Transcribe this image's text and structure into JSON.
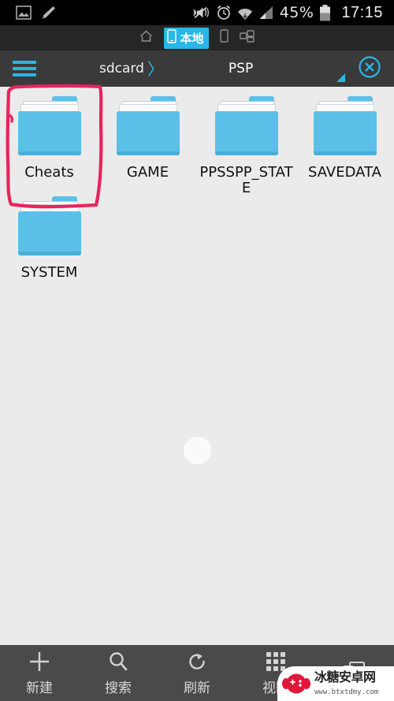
{
  "statusbar": {
    "left_icons": [
      {
        "name": "gallery-icon",
        "label": "gallery"
      },
      {
        "name": "pencil-icon",
        "label": "edit"
      }
    ],
    "right_icons": [
      {
        "name": "vibrate-mute-icon",
        "label": "silent"
      },
      {
        "name": "alarm-clock-icon",
        "label": "alarm"
      },
      {
        "name": "wifi-icon",
        "label": "wifi"
      },
      {
        "name": "signal-bars-icon",
        "label": "signal"
      }
    ],
    "battery_percent": "45%",
    "battery_icon": "battery-icon",
    "clock": "17:15"
  },
  "tabbar": {
    "items": [
      {
        "name": "tab-home",
        "icon": "home-icon",
        "label": "",
        "active": false
      },
      {
        "name": "tab-local",
        "icon": "phone-icon",
        "label": "本地",
        "active": true
      },
      {
        "name": "tab-device",
        "icon": "phone-icon",
        "label": "",
        "active": false
      },
      {
        "name": "tab-network",
        "icon": "network-share-icon",
        "label": "",
        "active": false
      }
    ]
  },
  "toolbar": {
    "menu_icon": "hamburger-menu-icon",
    "breadcrumb": [
      "sdcard",
      "PSP"
    ],
    "separator": "〉",
    "close_icon": "close-circle-icon",
    "accent_color": "#29b6e8"
  },
  "content": {
    "background_color": "#ebebeb",
    "folder_color": "#5bc0e8",
    "items": [
      {
        "name": "folder-cheats",
        "label": "Cheats",
        "icon": "folder-icon",
        "highlighted": true
      },
      {
        "name": "folder-game",
        "label": "GAME",
        "icon": "folder-icon",
        "highlighted": false
      },
      {
        "name": "folder-ppsspp-state",
        "label": "PPSSPP_STATE",
        "icon": "folder-icon",
        "highlighted": false
      },
      {
        "name": "folder-savedata",
        "label": "SAVEDATA",
        "icon": "folder-icon",
        "highlighted": false
      },
      {
        "name": "folder-system",
        "label": "SYSTEM",
        "icon": "folder-icon",
        "highlighted": false
      }
    ],
    "loading_indicator": "loading-spinner"
  },
  "annotation": {
    "color": "#e8245c",
    "target": "Cheats",
    "shape": "hand-drawn-rectangle"
  },
  "bottombar": {
    "items": [
      {
        "name": "bottom-new",
        "label": "新建",
        "icon": "plus-icon"
      },
      {
        "name": "bottom-search",
        "label": "搜索",
        "icon": "search-icon"
      },
      {
        "name": "bottom-refresh",
        "label": "刷新",
        "icon": "refresh-icon"
      },
      {
        "name": "bottom-view",
        "label": "视图",
        "icon": "grid-view-icon"
      },
      {
        "name": "bottom-more",
        "label": "",
        "icon": "window-icon"
      }
    ]
  },
  "watermark": {
    "site_name": "冰糖安卓网",
    "url": "www.btxtdmy.com",
    "logo": "gamepad-logo",
    "logo_color": "#e2173a"
  }
}
